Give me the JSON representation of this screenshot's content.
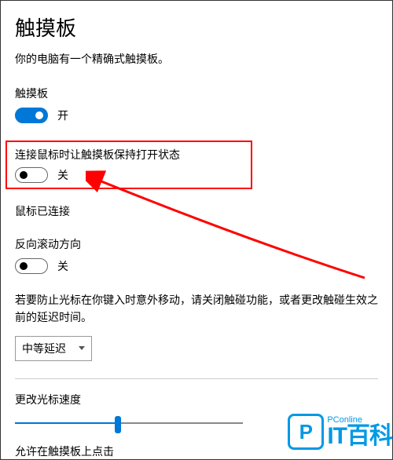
{
  "page": {
    "title": "触摸板",
    "subtitle": "你的电脑有一个精确式触摸板。"
  },
  "settings": {
    "touchpad": {
      "label": "触摸板",
      "state": "开",
      "on": true
    },
    "keep_on_mouse": {
      "label": "连接鼠标时让触摸板保持打开状态",
      "state": "关",
      "on": false
    },
    "mouse_status": "鼠标已连接",
    "reverse_scroll": {
      "label": "反向滚动方向",
      "state": "关",
      "on": false
    },
    "prevent_cursor_help": "若要防止光标在你键入时意外移动，请关闭触碰功能，或者更改触碰生效之前的延迟时间。",
    "delay_select": {
      "value": "中等延迟"
    },
    "cursor_speed": {
      "label": "更改光标速度"
    },
    "allow_tap": {
      "label": "允许在触摸板上点击"
    }
  },
  "watermark": {
    "small": "PConline",
    "big": "IT百科"
  }
}
